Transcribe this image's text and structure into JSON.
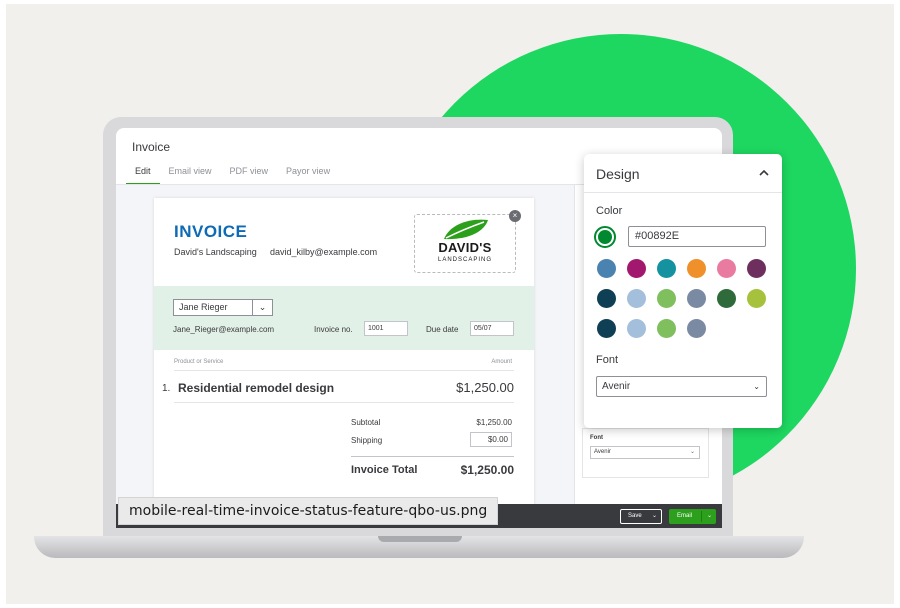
{
  "app": {
    "title": "Invoice"
  },
  "tabs": [
    {
      "label": "Edit",
      "active": true
    },
    {
      "label": "Email view",
      "active": false
    },
    {
      "label": "PDF view",
      "active": false
    },
    {
      "label": "Payor view",
      "active": false
    }
  ],
  "invoice": {
    "heading": "INVOICE",
    "company": "David's Landscaping",
    "company_email": "david_kilby@example.com",
    "logo": {
      "name": "DAVID'S",
      "sub": "LANDSCAPING",
      "close_glyph": "×"
    },
    "customer": {
      "name": "Jane Rieger",
      "email": "Jane_Rieger@example.com"
    },
    "invoice_no_label": "Invoice no.",
    "invoice_no": "1001",
    "due_date_label": "Due date",
    "due_date": "05/07",
    "columns": {
      "product": "Product or Service",
      "amount": "Amount"
    },
    "items": [
      {
        "num": "1.",
        "description": "Residential remodel design",
        "amount": "$1,250.00"
      }
    ],
    "subtotal_label": "Subtotal",
    "subtotal": "$1,250.00",
    "shipping_label": "Shipping",
    "shipping": "$0.00",
    "total_label": "Invoice Total",
    "total": "$1,250.00"
  },
  "side_panel": {
    "font_label": "Font",
    "font_value": "Avenir"
  },
  "footer": {
    "save_label": "Save",
    "email_label": "Email"
  },
  "caption": "mobile-real-time-invoice-status-feature-qbo-us.png",
  "design": {
    "title": "Design",
    "color_label": "Color",
    "hex_value": "#00892E",
    "selected_color": "#00892e",
    "swatch_rows": [
      [
        "#4a82b0",
        "#a3186f",
        "#1592a0",
        "#f0902a",
        "#ea7ba0",
        "#6e2f5e"
      ],
      [
        "#0f3f54",
        "#a4bfdb",
        "#7fbf5e",
        "#7b8aa3",
        "#2f6a3a",
        "#a6c23c"
      ],
      [
        "#0f3f54",
        "#a4bfdb",
        "#7fbf5e",
        "#7b8aa3"
      ]
    ],
    "font_label": "Font",
    "font_value": "Avenir"
  },
  "colors": {
    "accent_green": "#2ca01c",
    "brand_circle": "#1ed760",
    "invoice_blue": "#0d6ab5"
  }
}
